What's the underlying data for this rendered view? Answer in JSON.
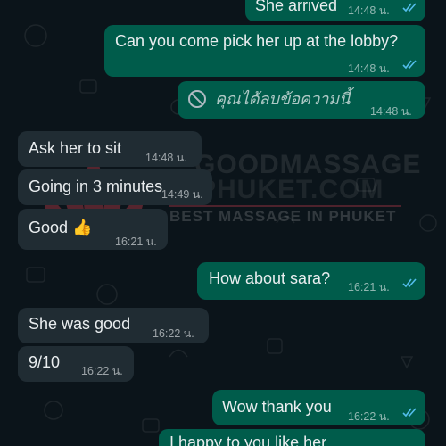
{
  "messages": [
    {
      "id": "m1",
      "dir": "out",
      "text": "She arrived",
      "time": "14:48 น.",
      "read": true
    },
    {
      "id": "m2",
      "dir": "out",
      "text": "Can you come pick her up at the lobby?",
      "time": "14:48 น.",
      "read": true
    },
    {
      "id": "m3",
      "dir": "out",
      "text": "คุณได้ลบข้อความนี้",
      "time": "14:48 น.",
      "deleted": true
    },
    {
      "id": "m4",
      "dir": "in",
      "text": "Ask her to sit",
      "time": "14:48 น."
    },
    {
      "id": "m5",
      "dir": "in",
      "text": "Going in 3 minutes",
      "time": "14:49 น."
    },
    {
      "id": "m6",
      "dir": "in",
      "text": "Good",
      "emoji": "👍",
      "time": "16:21 น."
    },
    {
      "id": "m7",
      "dir": "out",
      "text": "How about sara?",
      "time": "16:21 น.",
      "read": true
    },
    {
      "id": "m8",
      "dir": "in",
      "text": "She was good",
      "time": "16:22 น."
    },
    {
      "id": "m9",
      "dir": "in",
      "text": "9/10",
      "time": "16:22 น."
    },
    {
      "id": "m10",
      "dir": "out",
      "text": "Wow thank you",
      "time": "16:22 น.",
      "read": true
    },
    {
      "id": "m11",
      "dir": "out",
      "text": "I happy to you like her",
      "time": ""
    }
  ],
  "watermark": {
    "title": "GOODMASSAGE",
    "subtitle": "PHUKET.COM",
    "tagline": "BEST MASSAGE IN PHUKET"
  },
  "colors": {
    "background": "#0b141a",
    "outgoing_bubble": "#005c4b",
    "incoming_bubble": "#202c33",
    "read_ticks": "#53bdeb",
    "watermark_lotus": "#b03a48"
  },
  "icons": {
    "read_receipt": "double-check-icon",
    "deleted": "prohibited-icon",
    "logo": "lotus-logo"
  }
}
